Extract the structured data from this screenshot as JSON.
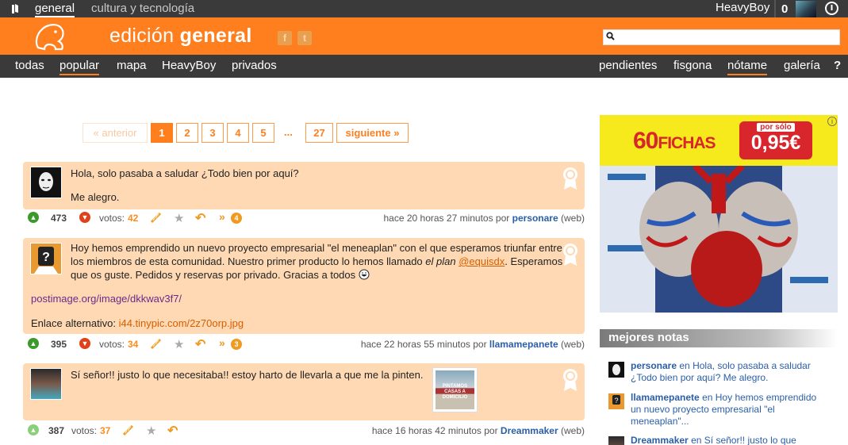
{
  "topbar": {
    "tabs": [
      "general",
      "cultura y tecnología"
    ],
    "username": "HeavyBoy",
    "notifications": "0"
  },
  "header": {
    "title_light": "edición",
    "title_bold": "general",
    "social": [
      "f",
      "t"
    ],
    "search_placeholder": ""
  },
  "nav": {
    "left": [
      "todas",
      "popular",
      "mapa",
      "HeavyBoy",
      "privados"
    ],
    "right": [
      "pendientes",
      "fisgona",
      "nótame",
      "galería",
      "?"
    ]
  },
  "pagination": {
    "prev": "« anterior",
    "pages": [
      "1",
      "2",
      "3",
      "4",
      "5"
    ],
    "dots": "...",
    "last": "27",
    "next": "siguiente »"
  },
  "notes": [
    {
      "lines": [
        "Hola, solo pasaba a saludar ¿Todo bien por aquí?",
        "",
        "Me alegro."
      ],
      "karma": "473",
      "votes_label": "votos:",
      "votes": "42",
      "replies": "4",
      "time": "hace 20 horas 27 minutos por",
      "user": "personare",
      "via": "(web)"
    },
    {
      "p1": "Hoy hemos emprendido un nuevo proyecto empresarial \"el meneaplan\" con el que esperamos triunfar entre los miembros de esta comunidad. Nuestro primer producto lo hemos llamado ",
      "p1_em": "el plan",
      "p1_mention": "@equisdx",
      "p1_end": ". Esperamos que os guste. Pedidos y reservas por privado. Gracias a todos",
      "link1": "postimage.org/image/dkkwav3f7/",
      "alt_label": "Enlace alternativo: ",
      "link2": "i44.tinypic.com/2z70orp.jpg",
      "karma": "395",
      "votes_label": "votos:",
      "votes": "34",
      "replies": "3",
      "time": "hace 22 horas 55 minutos por",
      "user": "llamamepanete",
      "via": "(web)"
    },
    {
      "text": "Sí señor!! justo lo que necesitaba!! estoy harto de llevarla a que me la pinten.",
      "thumb_text": "PINTAMOS CASAS A DOMICILIO",
      "karma": "387",
      "votes_label": "votos:",
      "votes": "37",
      "time": "hace 16 horas 42 minutos por",
      "user": "Dreammaker",
      "via": "(web)"
    }
  ],
  "ad": {
    "title_num": "60",
    "title_word": "FICHAS",
    "price_label": "por sólo",
    "price": "0,95€",
    "info": "i"
  },
  "sidebar": {
    "title": "mejores notas",
    "connector": "en",
    "items": [
      {
        "user": "personare",
        "text": "Hola, solo pasaba a saludar ¿Todo bien por aquí? Me alegro."
      },
      {
        "user": "llamamepanete",
        "text": "Hoy hemos emprendido un nuevo proyecto empresarial \"el meneaplan\"..."
      },
      {
        "user": "Dreammaker",
        "text": "Sí señor!! justo lo que"
      }
    ]
  }
}
